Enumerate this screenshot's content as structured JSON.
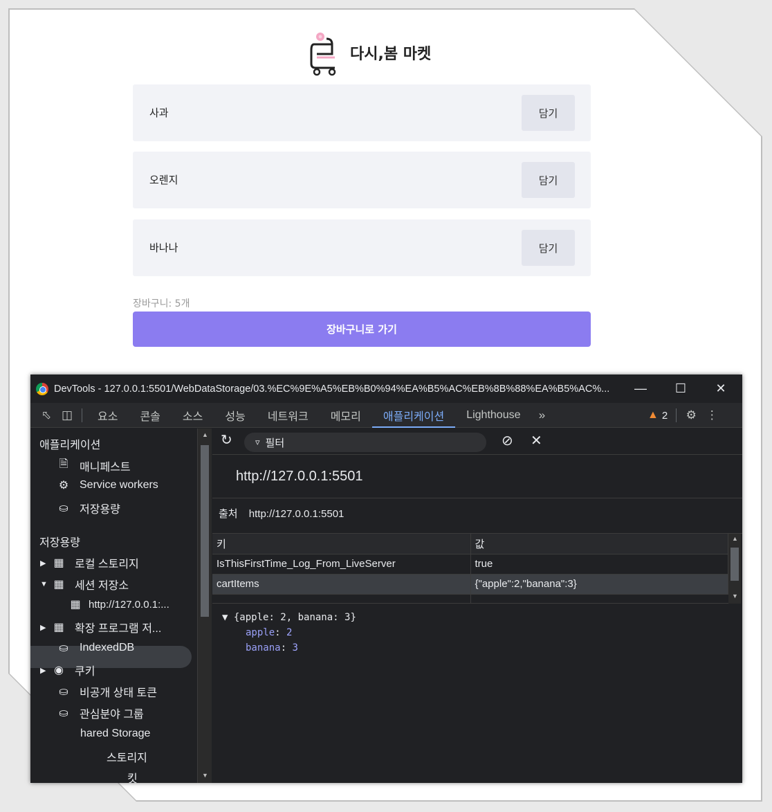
{
  "shop": {
    "brand_title": "다시,봄 마켓",
    "products": [
      {
        "name": "사과",
        "button": "담기"
      },
      {
        "name": "오렌지",
        "button": "담기"
      },
      {
        "name": "바나나",
        "button": "담기"
      }
    ],
    "cart_count": "장바구니: 5개",
    "go_cart_button": "장바구니로 가기"
  },
  "devtools": {
    "window_title": "DevTools - 127.0.0.1:5501/WebDataStorage/03.%EC%9E%A5%EB%B0%94%EA%B5%AC%EB%8B%88%EA%B5%AC%...",
    "tabs": [
      "요소",
      "콘솔",
      "소스",
      "성능",
      "네트워크",
      "메모리",
      "애플리케이션",
      "Lighthouse"
    ],
    "active_tab": "애플리케이션",
    "warning_count": "2",
    "sidebar": {
      "app_header": "애플리케이션",
      "app_items": [
        "매니페스트",
        "Service workers",
        "저장용량"
      ],
      "storage_header": "저장용량",
      "storage_items": {
        "local": "로컬 스토리지",
        "session": "세션 저장소",
        "session_child": "http://127.0.0.1:...",
        "extension": "확장 프로그램 저...",
        "indexeddb": "IndexedDB",
        "cookies": "쿠키",
        "private_token": "비공개 상태 토큰",
        "interest_group": "관심분야 그룹",
        "shared_storage": "hared Storage",
        "cache_storage": "스토리지",
        "bucket": "킷"
      }
    },
    "main": {
      "filter_placeholder": "필터",
      "origin_title": "http://127.0.0.1:5501",
      "origin_label": "출처",
      "origin_value": "http://127.0.0.1:5501",
      "columns": {
        "key": "키",
        "value": "값"
      },
      "rows": [
        {
          "key": "IsThisFirstTime_Log_From_LiveServer",
          "value": "true"
        },
        {
          "key": "cartItems",
          "value": "{\"apple\":2,\"banana\":3}"
        }
      ],
      "preview": {
        "summary": "{apple: 2, banana: 3}",
        "entries": [
          {
            "key": "apple",
            "value": "2"
          },
          {
            "key": "banana",
            "value": "3"
          }
        ]
      }
    }
  },
  "colors": {
    "primary_button": "#8b7cf0",
    "product_bg": "#f2f3f7",
    "devtools_bg": "#202124",
    "active_tab": "#7cacf8"
  }
}
